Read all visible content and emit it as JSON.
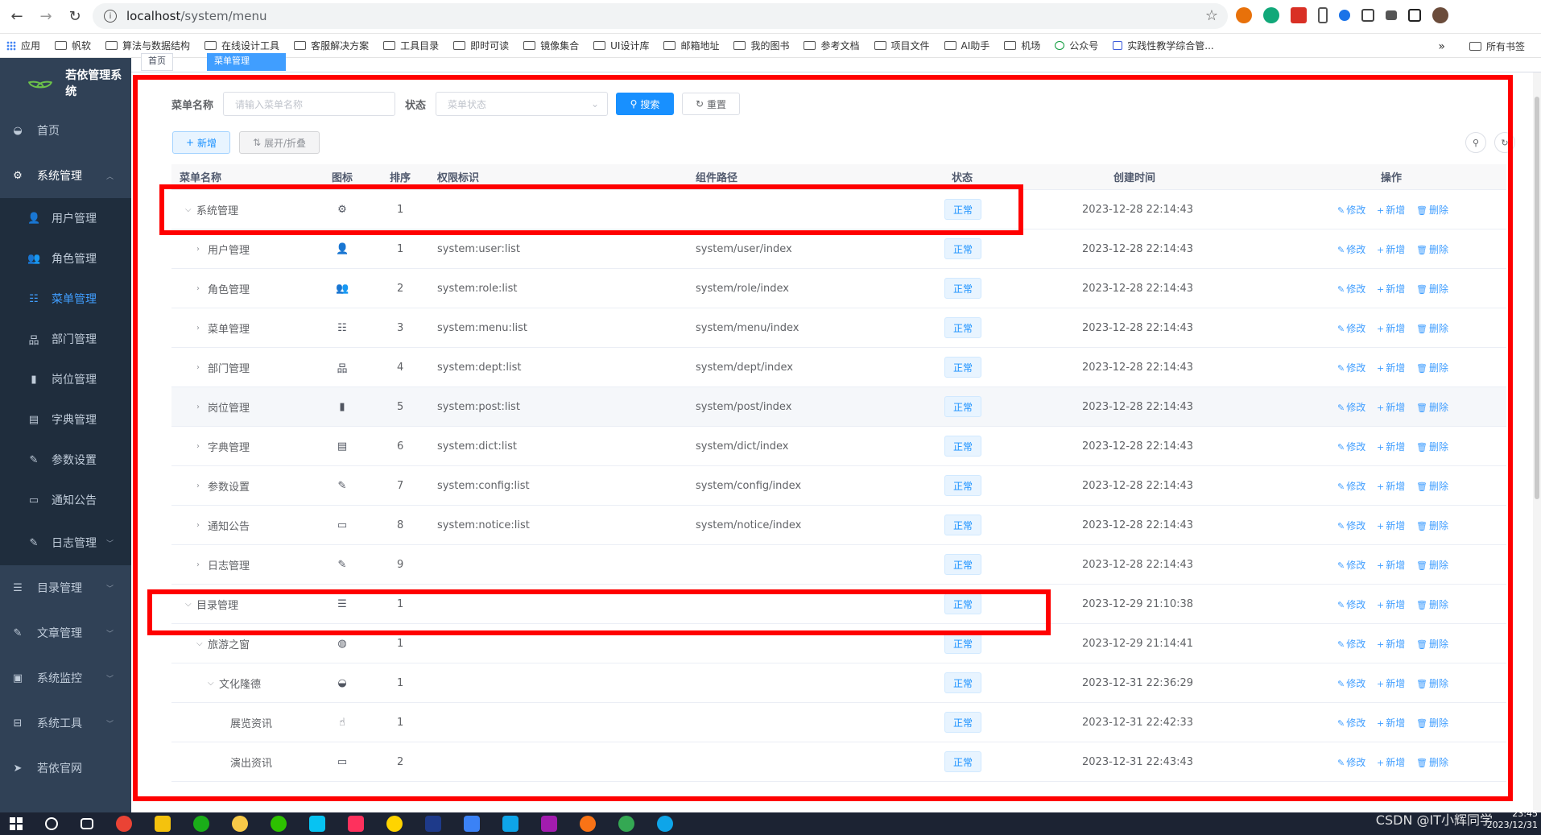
{
  "browser": {
    "url_host": "localhost",
    "url_path": "/system/menu",
    "bookmarks": [
      "应用",
      "帆软",
      "算法与数据结构",
      "在线设计工具",
      "客服解决方案",
      "工具目录",
      "即时可读",
      "镜像集合",
      "UI设计库",
      "邮箱地址",
      "我的图书",
      "参考文档",
      "项目文件",
      "AI助手",
      "机场",
      "公众号",
      "实践性教学综合管..."
    ],
    "bookmarks_more": "»",
    "bookmarks_right": "所有书签"
  },
  "sidebar": {
    "title": "若依管理系统",
    "items": [
      {
        "label": "首页",
        "icon": "dashboard-icon"
      },
      {
        "label": "系统管理",
        "icon": "gear-icon"
      },
      {
        "label": "目录管理",
        "icon": "list-icon"
      },
      {
        "label": "文章管理",
        "icon": "edit-icon"
      },
      {
        "label": "系统监控",
        "icon": "monitor-icon"
      },
      {
        "label": "系统工具",
        "icon": "toolbox-icon"
      },
      {
        "label": "若依官网",
        "icon": "send-icon"
      }
    ],
    "sub_items": [
      {
        "label": "用户管理",
        "icon": "user-icon"
      },
      {
        "label": "角色管理",
        "icon": "peoples-icon"
      },
      {
        "label": "菜单管理",
        "icon": "tree-table-icon"
      },
      {
        "label": "部门管理",
        "icon": "tree-icon"
      },
      {
        "label": "岗位管理",
        "icon": "post-icon"
      },
      {
        "label": "字典管理",
        "icon": "dict-icon"
      },
      {
        "label": "参数设置",
        "icon": "edit-icon"
      },
      {
        "label": "通知公告",
        "icon": "message-icon"
      },
      {
        "label": "日志管理",
        "icon": "log-icon"
      }
    ]
  },
  "tags": {
    "home": "首页",
    "current": "菜单管理"
  },
  "search": {
    "name_label": "菜单名称",
    "name_placeholder": "请输入菜单名称",
    "status_label": "状态",
    "status_placeholder": "菜单状态",
    "search_btn": "搜索",
    "reset_btn": "重置"
  },
  "toolbar": {
    "add_btn": "新增",
    "expand_btn": "展开/折叠"
  },
  "table": {
    "headers": [
      "菜单名称",
      "图标",
      "排序",
      "权限标识",
      "组件路径",
      "状态",
      "创建时间",
      "操作"
    ],
    "rows": [
      {
        "name": "系统管理",
        "icon": "gear-icon",
        "glyph": "⚙",
        "order": "1",
        "perm": "",
        "path": "",
        "status": "正常",
        "time": "2023-12-28 22:14:43",
        "level": 0,
        "exp": "⌵"
      },
      {
        "name": "用户管理",
        "icon": "user-icon",
        "glyph": "👤",
        "order": "1",
        "perm": "system:user:list",
        "path": "system/user/index",
        "status": "正常",
        "time": "2023-12-28 22:14:43",
        "level": 1,
        "exp": "›"
      },
      {
        "name": "角色管理",
        "icon": "peoples-icon",
        "glyph": "👥",
        "order": "2",
        "perm": "system:role:list",
        "path": "system/role/index",
        "status": "正常",
        "time": "2023-12-28 22:14:43",
        "level": 1,
        "exp": "›"
      },
      {
        "name": "菜单管理",
        "icon": "tree-table-icon",
        "glyph": "☷",
        "order": "3",
        "perm": "system:menu:list",
        "path": "system/menu/index",
        "status": "正常",
        "time": "2023-12-28 22:14:43",
        "level": 1,
        "exp": "›"
      },
      {
        "name": "部门管理",
        "icon": "tree-icon",
        "glyph": "品",
        "order": "4",
        "perm": "system:dept:list",
        "path": "system/dept/index",
        "status": "正常",
        "time": "2023-12-28 22:14:43",
        "level": 1,
        "exp": "›"
      },
      {
        "name": "岗位管理",
        "icon": "post-icon",
        "glyph": "▮",
        "order": "5",
        "perm": "system:post:list",
        "path": "system/post/index",
        "status": "正常",
        "time": "2023-12-28 22:14:43",
        "level": 1,
        "exp": "›"
      },
      {
        "name": "字典管理",
        "icon": "dict-icon",
        "glyph": "▤",
        "order": "6",
        "perm": "system:dict:list",
        "path": "system/dict/index",
        "status": "正常",
        "time": "2023-12-28 22:14:43",
        "level": 1,
        "exp": "›"
      },
      {
        "name": "参数设置",
        "icon": "edit-icon",
        "glyph": "✎",
        "order": "7",
        "perm": "system:config:list",
        "path": "system/config/index",
        "status": "正常",
        "time": "2023-12-28 22:14:43",
        "level": 1,
        "exp": "›"
      },
      {
        "name": "通知公告",
        "icon": "message-icon",
        "glyph": "▭",
        "order": "8",
        "perm": "system:notice:list",
        "path": "system/notice/index",
        "status": "正常",
        "time": "2023-12-28 22:14:43",
        "level": 1,
        "exp": "›"
      },
      {
        "name": "日志管理",
        "icon": "log-icon",
        "glyph": "✎",
        "order": "9",
        "perm": "",
        "path": "",
        "status": "正常",
        "time": "2023-12-28 22:14:43",
        "level": 1,
        "exp": "›"
      },
      {
        "name": "目录管理",
        "icon": "list-icon",
        "glyph": "☰",
        "order": "1",
        "perm": "",
        "path": "",
        "status": "正常",
        "time": "2023-12-29 21:10:38",
        "level": 0,
        "exp": "⌵"
      },
      {
        "name": "旅游之窗",
        "icon": "globe-icon",
        "glyph": "◍",
        "order": "1",
        "perm": "",
        "path": "",
        "status": "正常",
        "time": "2023-12-29 21:14:41",
        "level": 1,
        "exp": "⌵"
      },
      {
        "name": "文化隆德",
        "icon": "dashboard-icon",
        "glyph": "◒",
        "order": "1",
        "perm": "",
        "path": "",
        "status": "正常",
        "time": "2023-12-31 22:36:29",
        "level": 2,
        "exp": "⌵"
      },
      {
        "name": "展览资讯",
        "icon": "hand-icon",
        "glyph": "☝",
        "order": "1",
        "perm": "",
        "path": "",
        "status": "正常",
        "time": "2023-12-31 22:42:33",
        "level": 3,
        "exp": ""
      },
      {
        "name": "演出资讯",
        "icon": "message-icon",
        "glyph": "▭",
        "order": "2",
        "perm": "",
        "path": "",
        "status": "正常",
        "time": "2023-12-31 22:43:43",
        "level": 3,
        "exp": ""
      }
    ],
    "ops": {
      "edit": "修改",
      "add": "新增",
      "del": "删除"
    }
  },
  "taskbar": {
    "watermark": "CSDN @IT小辉同学",
    "time": "23:45",
    "date": "2023/12/31"
  },
  "colors": {
    "sidebar_bg": "#304156",
    "primary": "#1890ff",
    "annotation": "#ff0000"
  }
}
